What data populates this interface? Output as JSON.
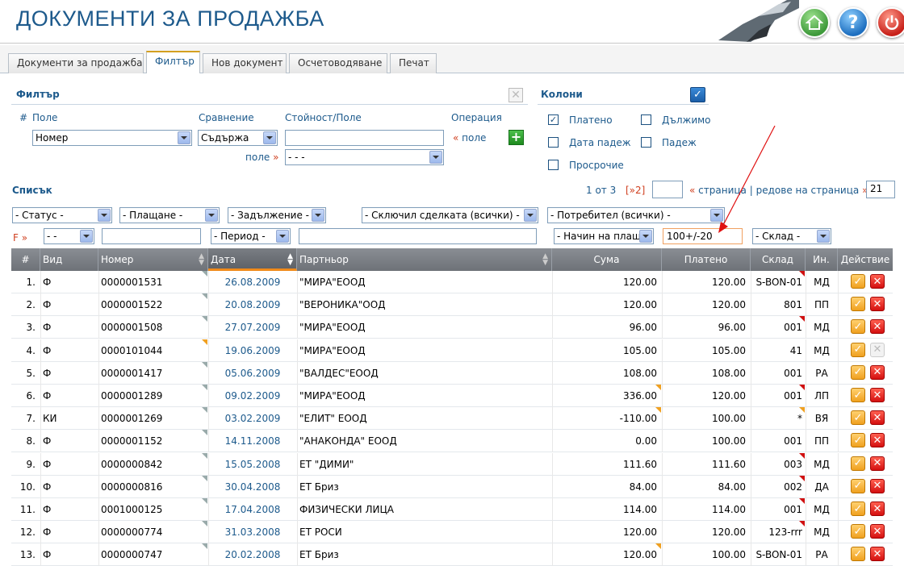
{
  "app": {
    "title": "ДОКУМЕНТИ ЗА ПРОДАЖБА"
  },
  "tabs": [
    {
      "label": "Документи за продажба"
    },
    {
      "label": "Филтър"
    },
    {
      "label": "Нов документ"
    },
    {
      "label": "Осчетоводяване"
    },
    {
      "label": "Печат"
    }
  ],
  "filter": {
    "title": "Филтър",
    "hash": "#",
    "field_label": "Поле",
    "compare_label": "Сравнение",
    "value_label": "Стойност/Поле",
    "operation_label": "Операция",
    "field_value": "Номер",
    "compare_value": "Съдържа",
    "value_input": "",
    "op_arrow": "«",
    "op_field": "поле",
    "field_link": "поле",
    "field_link_arrow": "»",
    "second_select": "- - -"
  },
  "columns_panel": {
    "title": "Колони",
    "items": [
      {
        "label": "Платено",
        "checked": true
      },
      {
        "label": "Дължимо",
        "checked": false
      },
      {
        "label": "Дата падеж",
        "checked": false
      },
      {
        "label": "Падеж",
        "checked": false
      },
      {
        "label": "Просрочие",
        "checked": false
      }
    ]
  },
  "list": {
    "title": "Списък",
    "pager_text": "1 от 3",
    "next_page": "[»2]",
    "page_input": "",
    "page_link_arrow": "«",
    "page_link": "страница",
    "separator": "|",
    "rows_per_page_label": "редове на страница",
    "rows_per_page_arrow": "»",
    "rows_per_page_value": "21"
  },
  "filters_row1": {
    "status": "- Статус -",
    "payment": "- Плащане -",
    "obligation": "- Задължение -",
    "deal_by": "- Сключил сделката (всички) -",
    "user": "- Потребител (всички) -"
  },
  "filters_row2": {
    "f_label": "F »",
    "type": "- -",
    "number": "",
    "period": "- Период -",
    "partner": "",
    "pay_method": "- Начин на плащ",
    "paid_value": "100+/-20",
    "warehouse": "- Склад -"
  },
  "table": {
    "headers": [
      "#",
      "Вид",
      "Номер",
      "Дата",
      "Партньор",
      "Сума",
      "Платено",
      "Склад",
      "Ин.",
      "Действие"
    ],
    "rows": [
      {
        "n": "1.",
        "type": "Ф",
        "number": "0000001531",
        "date": "26.08.2009",
        "partner": "\"МИРА\"ЕООД",
        "sum": "120.00",
        "paid": "120.00",
        "wh": "S-BON-01",
        "init": "МД"
      },
      {
        "n": "2.",
        "type": "Ф",
        "number": "0000001522",
        "date": "20.08.2009",
        "partner": "\"ВЕРОНИКА\"ООД",
        "sum": "120.00",
        "paid": "120.00",
        "wh": "801",
        "init": "ПП"
      },
      {
        "n": "3.",
        "type": "Ф",
        "number": "0000001508",
        "date": "27.07.2009",
        "partner": "\"МИРА\"ЕООД",
        "sum": "96.00",
        "paid": "96.00",
        "wh": "001",
        "init": "МД"
      },
      {
        "n": "4.",
        "type": "Ф",
        "number": "0000101044",
        "date": "19.06.2009",
        "partner": "\"МИРА\"ЕООД",
        "sum": "105.00",
        "paid": "105.00",
        "wh": "41",
        "init": "МД"
      },
      {
        "n": "5.",
        "type": "Ф",
        "number": "0000001417",
        "date": "05.06.2009",
        "partner": "\"ВАЛДЕС\"ЕООД",
        "sum": "108.00",
        "paid": "108.00",
        "wh": "001",
        "init": "РА"
      },
      {
        "n": "6.",
        "type": "Ф",
        "number": "0000001289",
        "date": "09.02.2009",
        "partner": "\"МИРА\"ЕООД",
        "sum": "336.00",
        "paid": "120.00",
        "wh": "001",
        "init": "ЛП"
      },
      {
        "n": "7.",
        "type": "КИ",
        "number": "0000001269",
        "date": "03.02.2009",
        "partner": "\"ЕЛИТ\" ЕООД",
        "sum": "-110.00",
        "paid": "100.00",
        "wh": "*",
        "init": "ВЯ"
      },
      {
        "n": "8.",
        "type": "Ф",
        "number": "0000001152",
        "date": "14.11.2008",
        "partner": "\"АНАКОНДА\" ЕООД",
        "sum": "0.00",
        "paid": "100.00",
        "wh": "001",
        "init": "ПП"
      },
      {
        "n": "9.",
        "type": "Ф",
        "number": "0000000842",
        "date": "15.05.2008",
        "partner": "ЕТ \"ДИМИ\"",
        "sum": "111.60",
        "paid": "111.60",
        "wh": "003",
        "init": "МД"
      },
      {
        "n": "10.",
        "type": "Ф",
        "number": "0000000816",
        "date": "30.04.2008",
        "partner": "ЕТ Бриз",
        "sum": "84.00",
        "paid": "84.00",
        "wh": "002",
        "init": "ДА"
      },
      {
        "n": "11.",
        "type": "Ф",
        "number": "0001000125",
        "date": "17.04.2008",
        "partner": "ФИЗИЧЕСКИ ЛИЦА",
        "sum": "114.00",
        "paid": "114.00",
        "wh": "001",
        "init": "МД"
      },
      {
        "n": "12.",
        "type": "Ф",
        "number": "0000000774",
        "date": "31.03.2008",
        "partner": "ЕТ РОСИ",
        "sum": "120.00",
        "paid": "120.00",
        "wh": "123-rrr",
        "init": "МД"
      },
      {
        "n": "13.",
        "type": "Ф",
        "number": "0000000747",
        "date": "20.02.2008",
        "partner": "ЕТ Бриз",
        "sum": "120.00",
        "paid": "100.00",
        "wh": "S-BON-01",
        "init": "РА"
      }
    ]
  },
  "icons": {
    "home": "home-icon",
    "help": "help-icon",
    "power": "power-icon"
  },
  "colors": {
    "title": "#1d5a8c",
    "accent": "#d04020",
    "header_bg": "#7a7e84"
  }
}
